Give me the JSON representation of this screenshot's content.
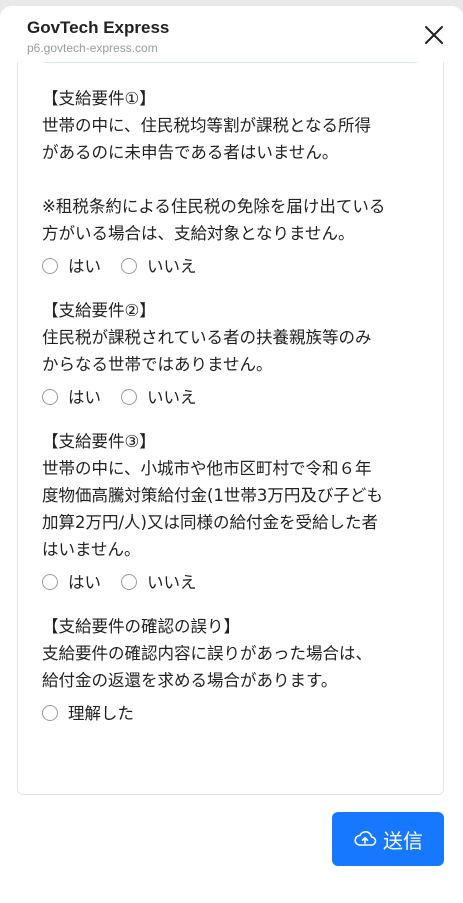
{
  "header": {
    "title": "GovTech Express",
    "url": "p6.govtech-express.com"
  },
  "sections": [
    {
      "title": "【支給要件①】",
      "text": "世帯の中に、住民税均等割が課税となる所得\nがあるのに未申告である者はいません。\n\n※租税条約による住民税の免除を届け出ている\n方がいる場合は、支給対象となりません。",
      "options": [
        "はい",
        "いいえ"
      ]
    },
    {
      "title": "【支給要件②】",
      "text": "住民税が課税されている者の扶養親族等のみ\nからなる世帯ではありません。",
      "options": [
        "はい",
        "いいえ"
      ]
    },
    {
      "title": "【支給要件③】",
      "text": "世帯の中に、小城市や他市区町村で令和６年\n度物価高騰対策給付金(1世帯3万円及び子ども\n加算2万円/人)又は同様の給付金を受給した者\nはいません。",
      "options": [
        "はい",
        "いいえ"
      ]
    },
    {
      "title": "【支給要件の確認の誤り】",
      "text": "支給要件の確認内容に誤りがあった場合は、\n給付金の返還を求める場合があります。",
      "options": [
        "理解した"
      ]
    }
  ],
  "submit": {
    "label": "送信",
    "icon": "cloud-upload-icon"
  },
  "colors": {
    "primary": "#1677ff",
    "strip": "#d3eee9"
  }
}
